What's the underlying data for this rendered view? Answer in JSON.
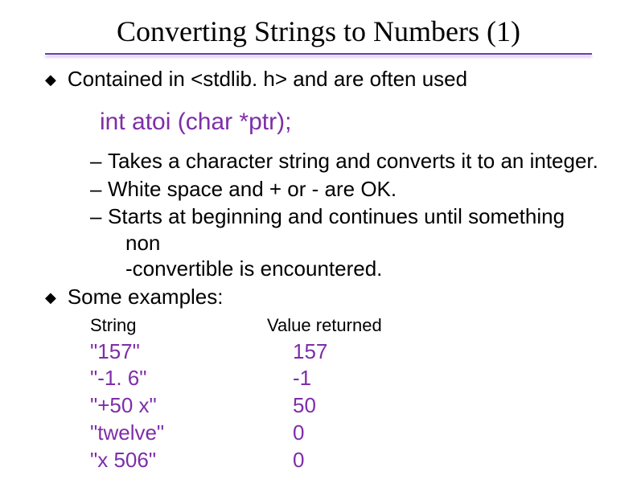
{
  "title": "Converting Strings to Numbers (1)",
  "bullet1": "Contained in <stdlib. h> and are often used",
  "code_line": "int atoi (char *ptr);",
  "sub": {
    "s1": "Takes a character string and converts it to an integer.",
    "s2": "White space and + or - are OK.",
    "s3a": "Starts at beginning and continues until something non",
    "s3b": "-convertible is encountered."
  },
  "bullet2": "Some examples:",
  "table": {
    "headers": {
      "a": "String",
      "b": "Value returned"
    },
    "rows": [
      {
        "a": "\"157\"",
        "b": "157"
      },
      {
        "a": "\"-1. 6\"",
        "b": "-1"
      },
      {
        "a": "\"+50 x\"",
        "b": "50"
      },
      {
        "a": "\"twelve\"",
        "b": "0"
      },
      {
        "a": "\"x 506\"",
        "b": "0"
      }
    ]
  }
}
